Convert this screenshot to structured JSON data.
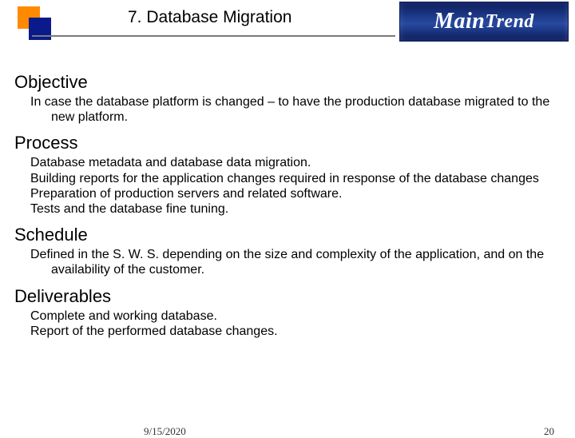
{
  "header": {
    "title": "7. Database Migration",
    "logo_text_main": "Main",
    "logo_text_trend": "Trend"
  },
  "sections": [
    {
      "heading": "Objective",
      "items": [
        "In case the database platform is changed – to have the production database migrated to the new platform."
      ]
    },
    {
      "heading": "Process",
      "items": [
        "Database metadata and database data migration.",
        "Building reports for the application changes required in response of the database changes",
        "Preparation of production servers and related software.",
        "Tests and the database fine tuning."
      ]
    },
    {
      "heading": "Schedule",
      "items": [
        "Defined in the S. W. S. depending on the size and complexity of the application, and on the availability of the customer."
      ]
    },
    {
      "heading": "Deliverables",
      "items": [
        "Complete and working database.",
        "Report of the performed database changes."
      ]
    }
  ],
  "footer": {
    "date": "9/15/2020",
    "page_number": "20"
  }
}
